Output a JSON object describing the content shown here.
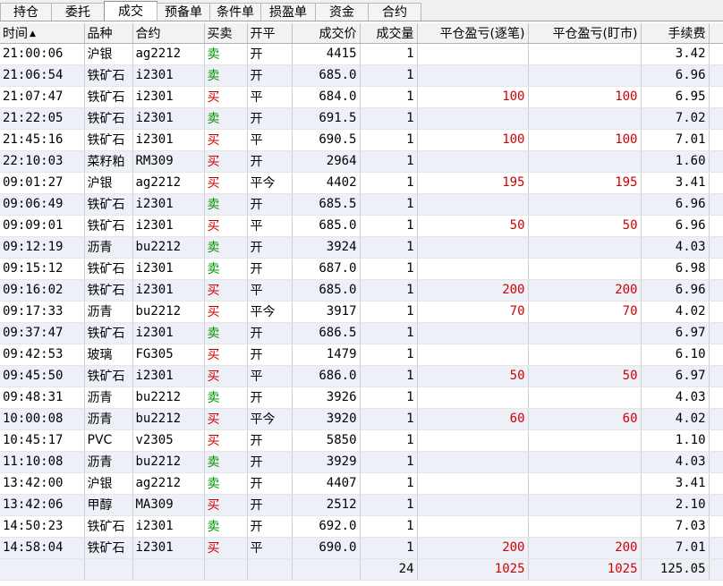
{
  "tabs": [
    {
      "label": "持仓",
      "width": 58
    },
    {
      "label": "委托",
      "width": 60
    },
    {
      "label": "成交",
      "width": 60,
      "active": true
    },
    {
      "label": "预备单",
      "width": 60
    },
    {
      "label": "条件单",
      "width": 58
    },
    {
      "label": "损盈单",
      "width": 62
    },
    {
      "label": "资金",
      "width": 60
    },
    {
      "label": "合约",
      "width": 60
    }
  ],
  "columns": [
    "时间",
    "品种",
    "合约",
    "买卖",
    "开平",
    "成交价",
    "成交量",
    "平仓盈亏(逐笔)",
    "平仓盈亏(盯市)",
    "手续费"
  ],
  "sort_icon": "▲",
  "rows": [
    {
      "time": "21:00:06",
      "variety": "沪银",
      "contract": "ag2212",
      "side": "卖",
      "oc": "开",
      "price": "4415",
      "qty": "1",
      "pnl_trade": "",
      "pnl_mtm": "",
      "fee": "3.42"
    },
    {
      "time": "21:06:54",
      "variety": "铁矿石",
      "contract": "i2301",
      "side": "卖",
      "oc": "开",
      "price": "685.0",
      "qty": "1",
      "pnl_trade": "",
      "pnl_mtm": "",
      "fee": "6.96"
    },
    {
      "time": "21:07:47",
      "variety": "铁矿石",
      "contract": "i2301",
      "side": "买",
      "oc": "平",
      "price": "684.0",
      "qty": "1",
      "pnl_trade": "100",
      "pnl_mtm": "100",
      "fee": "6.95"
    },
    {
      "time": "21:22:05",
      "variety": "铁矿石",
      "contract": "i2301",
      "side": "卖",
      "oc": "开",
      "price": "691.5",
      "qty": "1",
      "pnl_trade": "",
      "pnl_mtm": "",
      "fee": "7.02"
    },
    {
      "time": "21:45:16",
      "variety": "铁矿石",
      "contract": "i2301",
      "side": "买",
      "oc": "平",
      "price": "690.5",
      "qty": "1",
      "pnl_trade": "100",
      "pnl_mtm": "100",
      "fee": "7.01"
    },
    {
      "time": "22:10:03",
      "variety": "菜籽粕",
      "contract": "RM309",
      "side": "买",
      "oc": "开",
      "price": "2964",
      "qty": "1",
      "pnl_trade": "",
      "pnl_mtm": "",
      "fee": "1.60"
    },
    {
      "time": "09:01:27",
      "variety": "沪银",
      "contract": "ag2212",
      "side": "买",
      "oc": "平今",
      "price": "4402",
      "qty": "1",
      "pnl_trade": "195",
      "pnl_mtm": "195",
      "fee": "3.41"
    },
    {
      "time": "09:06:49",
      "variety": "铁矿石",
      "contract": "i2301",
      "side": "卖",
      "oc": "开",
      "price": "685.5",
      "qty": "1",
      "pnl_trade": "",
      "pnl_mtm": "",
      "fee": "6.96"
    },
    {
      "time": "09:09:01",
      "variety": "铁矿石",
      "contract": "i2301",
      "side": "买",
      "oc": "平",
      "price": "685.0",
      "qty": "1",
      "pnl_trade": "50",
      "pnl_mtm": "50",
      "fee": "6.96"
    },
    {
      "time": "09:12:19",
      "variety": "沥青",
      "contract": "bu2212",
      "side": "卖",
      "oc": "开",
      "price": "3924",
      "qty": "1",
      "pnl_trade": "",
      "pnl_mtm": "",
      "fee": "4.03"
    },
    {
      "time": "09:15:12",
      "variety": "铁矿石",
      "contract": "i2301",
      "side": "卖",
      "oc": "开",
      "price": "687.0",
      "qty": "1",
      "pnl_trade": "",
      "pnl_mtm": "",
      "fee": "6.98"
    },
    {
      "time": "09:16:02",
      "variety": "铁矿石",
      "contract": "i2301",
      "side": "买",
      "oc": "平",
      "price": "685.0",
      "qty": "1",
      "pnl_trade": "200",
      "pnl_mtm": "200",
      "fee": "6.96"
    },
    {
      "time": "09:17:33",
      "variety": "沥青",
      "contract": "bu2212",
      "side": "买",
      "oc": "平今",
      "price": "3917",
      "qty": "1",
      "pnl_trade": "70",
      "pnl_mtm": "70",
      "fee": "4.02"
    },
    {
      "time": "09:37:47",
      "variety": "铁矿石",
      "contract": "i2301",
      "side": "卖",
      "oc": "开",
      "price": "686.5",
      "qty": "1",
      "pnl_trade": "",
      "pnl_mtm": "",
      "fee": "6.97"
    },
    {
      "time": "09:42:53",
      "variety": "玻璃",
      "contract": "FG305",
      "side": "买",
      "oc": "开",
      "price": "1479",
      "qty": "1",
      "pnl_trade": "",
      "pnl_mtm": "",
      "fee": "6.10"
    },
    {
      "time": "09:45:50",
      "variety": "铁矿石",
      "contract": "i2301",
      "side": "买",
      "oc": "平",
      "price": "686.0",
      "qty": "1",
      "pnl_trade": "50",
      "pnl_mtm": "50",
      "fee": "6.97"
    },
    {
      "time": "09:48:31",
      "variety": "沥青",
      "contract": "bu2212",
      "side": "卖",
      "oc": "开",
      "price": "3926",
      "qty": "1",
      "pnl_trade": "",
      "pnl_mtm": "",
      "fee": "4.03"
    },
    {
      "time": "10:00:08",
      "variety": "沥青",
      "contract": "bu2212",
      "side": "买",
      "oc": "平今",
      "price": "3920",
      "qty": "1",
      "pnl_trade": "60",
      "pnl_mtm": "60",
      "fee": "4.02"
    },
    {
      "time": "10:45:17",
      "variety": "PVC",
      "contract": "v2305",
      "side": "买",
      "oc": "开",
      "price": "5850",
      "qty": "1",
      "pnl_trade": "",
      "pnl_mtm": "",
      "fee": "1.10"
    },
    {
      "time": "11:10:08",
      "variety": "沥青",
      "contract": "bu2212",
      "side": "卖",
      "oc": "开",
      "price": "3929",
      "qty": "1",
      "pnl_trade": "",
      "pnl_mtm": "",
      "fee": "4.03"
    },
    {
      "time": "13:42:00",
      "variety": "沪银",
      "contract": "ag2212",
      "side": "卖",
      "oc": "开",
      "price": "4407",
      "qty": "1",
      "pnl_trade": "",
      "pnl_mtm": "",
      "fee": "3.41"
    },
    {
      "time": "13:42:06",
      "variety": "甲醇",
      "contract": "MA309",
      "side": "买",
      "oc": "开",
      "price": "2512",
      "qty": "1",
      "pnl_trade": "",
      "pnl_mtm": "",
      "fee": "2.10"
    },
    {
      "time": "14:50:23",
      "variety": "铁矿石",
      "contract": "i2301",
      "side": "卖",
      "oc": "开",
      "price": "692.0",
      "qty": "1",
      "pnl_trade": "",
      "pnl_mtm": "",
      "fee": "7.03"
    },
    {
      "time": "14:58:04",
      "variety": "铁矿石",
      "contract": "i2301",
      "side": "买",
      "oc": "平",
      "price": "690.0",
      "qty": "1",
      "pnl_trade": "200",
      "pnl_mtm": "200",
      "fee": "7.01"
    }
  ],
  "totals": {
    "qty": "24",
    "pnl_trade": "1025",
    "pnl_mtm": "1025",
    "fee": "125.05"
  },
  "colors": {
    "buy": "#d00000",
    "sell": "#009000",
    "row_alt": "#eef0f8"
  }
}
